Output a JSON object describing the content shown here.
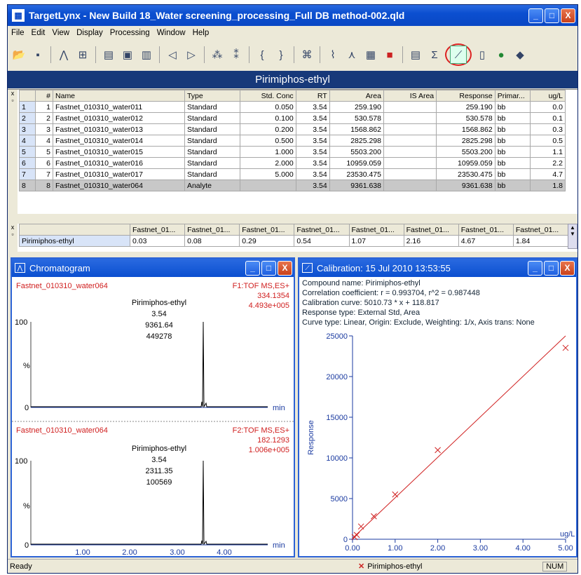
{
  "window": {
    "title": "TargetLynx - New Build 18_Water screening_processing_Full DB method-002.qld",
    "min": "_",
    "max": "□",
    "close": "X"
  },
  "menu": [
    "File",
    "Edit",
    "View",
    "Display",
    "Processing",
    "Window",
    "Help"
  ],
  "toolbar_icons": [
    "open-folder-icon",
    "save-icon",
    "peak-icon",
    "integrate-icon",
    "report-icon",
    "display-icon",
    "print-icon",
    "arrow-left-icon",
    "arrow-right-icon",
    "molecule-icon",
    "molecule-dropdown-icon",
    "brace-left-icon",
    "brace-right-icon",
    "fit-icon",
    "chromatogram-view-icon",
    "spectrum-view-icon",
    "bar-chart-icon",
    "colors-icon",
    "grid-view-icon",
    "sum-icon",
    "calibration-view-icon",
    "book-icon",
    "globe-icon",
    "eraser-icon"
  ],
  "compound_banner": "Pirimiphos-ethyl",
  "table": {
    "headers": [
      "#",
      "Name",
      "Type",
      "Std. Conc",
      "RT",
      "Area",
      "IS Area",
      "Response",
      "Primar...",
      "ug/L"
    ],
    "rows": [
      [
        "1",
        "1",
        "Fastnet_010310_water011",
        "Standard",
        "0.050",
        "3.54",
        "259.190",
        "",
        "259.190",
        "bb",
        "0.0"
      ],
      [
        "2",
        "2",
        "Fastnet_010310_water012",
        "Standard",
        "0.100",
        "3.54",
        "530.578",
        "",
        "530.578",
        "bb",
        "0.1"
      ],
      [
        "3",
        "3",
        "Fastnet_010310_water013",
        "Standard",
        "0.200",
        "3.54",
        "1568.862",
        "",
        "1568.862",
        "bb",
        "0.3"
      ],
      [
        "4",
        "4",
        "Fastnet_010310_water014",
        "Standard",
        "0.500",
        "3.54",
        "2825.298",
        "",
        "2825.298",
        "bb",
        "0.5"
      ],
      [
        "5",
        "5",
        "Fastnet_010310_water015",
        "Standard",
        "1.000",
        "3.54",
        "5503.200",
        "",
        "5503.200",
        "bb",
        "1.1"
      ],
      [
        "6",
        "6",
        "Fastnet_010310_water016",
        "Standard",
        "2.000",
        "3.54",
        "10959.059",
        "",
        "10959.059",
        "bb",
        "2.2"
      ],
      [
        "7",
        "7",
        "Fastnet_010310_water017",
        "Standard",
        "5.000",
        "3.54",
        "23530.475",
        "",
        "23530.475",
        "bb",
        "4.7"
      ],
      [
        "8",
        "8",
        "Fastnet_010310_water064",
        "Analyte",
        "",
        "3.54",
        "9361.638",
        "",
        "9361.638",
        "bb",
        "1.8"
      ]
    ]
  },
  "summary": {
    "headers": [
      "Fastnet_01...",
      "Fastnet_01...",
      "Fastnet_01...",
      "Fastnet_01...",
      "Fastnet_01...",
      "Fastnet_01...",
      "Fastnet_01...",
      "Fastnet_01..."
    ],
    "label": "Pirimiphos-ethyl",
    "values": [
      "0.03",
      "0.08",
      "0.29",
      "0.54",
      "1.07",
      "2.16",
      "4.67",
      "1.84"
    ]
  },
  "chromatogram": {
    "title": "Chromatogram",
    "traces": [
      {
        "sample": "Fastnet_010310_water064",
        "function": "F1:TOF MS,ES+",
        "mass": "334.1354",
        "intensity": "4.493e+005",
        "peak_name": "Pirimiphos-ethyl",
        "peak_rt": "3.54",
        "peak_area": "9361.64",
        "peak_height": "449278",
        "y100": "100",
        "ypct": "%",
        "y0": "0",
        "xunit": "min"
      },
      {
        "sample": "Fastnet_010310_water064",
        "function": "F2:TOF MS,ES+",
        "mass": "182.1293",
        "intensity": "1.006e+005",
        "peak_name": "Pirimiphos-ethyl",
        "peak_rt": "3.54",
        "peak_area": "2311.35",
        "peak_height": "100569",
        "y100": "100",
        "ypct": "%",
        "y0": "0",
        "xunit": "min"
      }
    ],
    "xticks": [
      "1.00",
      "2.00",
      "3.00",
      "4.00"
    ]
  },
  "calibration": {
    "title": "Calibration: 15 Jul 2010 13:53:55",
    "info": [
      "Compound name: Pirimiphos-ethyl",
      "Correlation coefficient: r = 0.993704, r^2 = 0.987448",
      "Calibration curve: 5010.73 * x + 118.817",
      "Response type: External Std, Area",
      "Curve type: Linear, Origin: Exclude, Weighting: 1/x, Axis trans: None"
    ]
  },
  "chart_data": {
    "type": "scatter",
    "title": "",
    "xlabel": "ug/L",
    "ylabel": "Response",
    "xlim": [
      0,
      5
    ],
    "ylim": [
      0,
      25000
    ],
    "xticks": [
      "0.00",
      "1.00",
      "2.00",
      "3.00",
      "4.00",
      "5.00"
    ],
    "yticks": [
      "0",
      "5000",
      "10000",
      "15000",
      "20000",
      "25000"
    ],
    "points": [
      [
        0.05,
        259.19
      ],
      [
        0.1,
        530.578
      ],
      [
        0.2,
        1568.862
      ],
      [
        0.5,
        2825.298
      ],
      [
        1.0,
        5503.2
      ],
      [
        2.0,
        10959.059
      ],
      [
        5.0,
        23530.475
      ]
    ],
    "fit": {
      "slope": 5010.73,
      "intercept": 118.817
    },
    "colors": {
      "line": "#d02020",
      "points": "#d02020"
    }
  },
  "status": {
    "left": "Ready",
    "compound": "Pirimiphos-ethyl",
    "num": "NUM"
  }
}
